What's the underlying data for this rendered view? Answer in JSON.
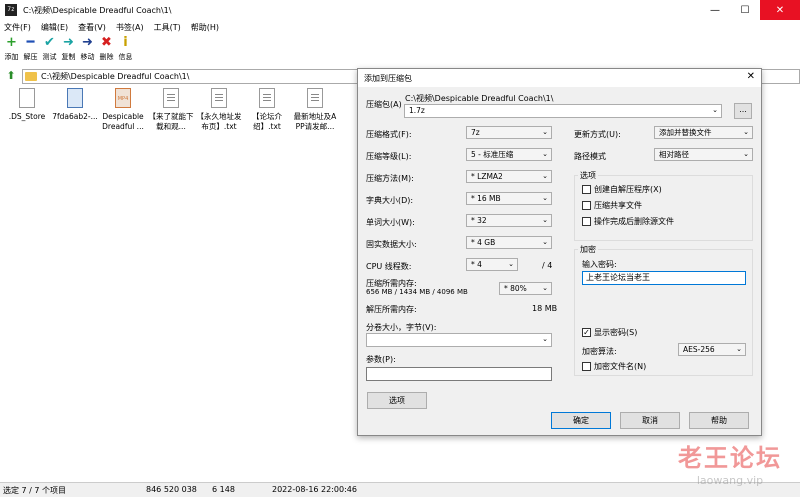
{
  "window": {
    "app_icon": "7z",
    "title": "C:\\视频\\Despicable Dreadful Coach\\1\\",
    "controls": {
      "minimize": "—",
      "maximize": "☐",
      "close": "✕"
    }
  },
  "menu": [
    "文件(F)",
    "编辑(E)",
    "查看(V)",
    "书签(A)",
    "工具(T)",
    "帮助(H)"
  ],
  "toolbar": [
    {
      "label": "添加",
      "icon": "plus-icon",
      "glyph": "+",
      "color": "#2ca02c"
    },
    {
      "label": "解压",
      "icon": "minus-icon",
      "glyph": "━",
      "color": "#1f4fb5"
    },
    {
      "label": "测试",
      "icon": "test-check-icon",
      "glyph": "✔",
      "color": "#1aa3a3"
    },
    {
      "label": "复制",
      "icon": "copy-arrow-icon",
      "glyph": "➜",
      "color": "#1aa3a3"
    },
    {
      "label": "移动",
      "icon": "move-arrow-icon",
      "glyph": "➜",
      "color": "#1f3f8f"
    },
    {
      "label": "删除",
      "icon": "delete-x-icon",
      "glyph": "✖",
      "color": "#d62020"
    },
    {
      "label": "信息",
      "icon": "info-icon",
      "glyph": "i",
      "color": "#c8a000"
    }
  ],
  "address": {
    "path": "C:\\视频\\Despicable Dreadful Coach\\1\\"
  },
  "files": [
    {
      "name": ".DS_Store",
      "type": "blank"
    },
    {
      "name": "7fda6ab2-...",
      "type": "img"
    },
    {
      "name": "Despicable Dreadful ...",
      "type": "mp4",
      "badge": "MP4"
    },
    {
      "name": "【来了就能下载和观...",
      "type": "txt"
    },
    {
      "name": "【永久地址发布页】.txt",
      "type": "txt"
    },
    {
      "name": "【论坛介绍】.txt",
      "type": "txt"
    },
    {
      "name": "最新地址及APP请发邮...",
      "type": "txt"
    }
  ],
  "status": {
    "selection": "选定 7 / 7 个项目",
    "size": "846 520 038",
    "packed": "6 148",
    "modified": "2022-08-16 22:00:46"
  },
  "watermark": {
    "text": "老王论坛",
    "url": "laowang.vip"
  },
  "dialog": {
    "title": "添加到压缩包",
    "close": "✕",
    "archive_label": "压缩包(A)",
    "archive_dir": "C:\\视频\\Despicable Dreadful Coach\\1\\",
    "archive_name": "1.7z",
    "browse": "...",
    "format_label": "压缩格式(F):",
    "format": "7z",
    "level_label": "压缩等级(L):",
    "level": "5 - 标准压缩",
    "method_label": "压缩方法(M):",
    "method": "* LZMA2",
    "dict_label": "字典大小(D):",
    "dict": "* 16 MB",
    "word_label": "单词大小(W):",
    "word": "* 32",
    "solid_label": "固实数据大小:",
    "solid": "* 4 GB",
    "cpu_label": "CPU 线程数:",
    "cpu": "* 4",
    "cpu_total": "/ 4",
    "mem_label": "压缩所需内存:",
    "mem_value": "656 MB / 1434 MB / 4096 MB",
    "mem_percent": "* 80%",
    "decomp_label": "解压所需内存:",
    "decomp_value": "18 MB",
    "split_label": "分卷大小，字节(V):",
    "split_value": "",
    "params_label": "参数(P):",
    "params_value": "",
    "options_btn": "选项",
    "update_label": "更新方式(U):",
    "update": "添加并替换文件",
    "path_label": "路径模式",
    "path_mode": "相对路径",
    "opts_group": "选项",
    "opt_sfx": "创建自解压程序(X)",
    "opt_shared": "压缩共享文件",
    "opt_delete": "操作完成后删除源文件",
    "enc_group": "加密",
    "pwd_label": "输入密码:",
    "pwd_value": "上老王论坛当老王",
    "show_pwd": "显示密码(S)",
    "enc_method_label": "加密算法:",
    "enc_method": "AES-256",
    "enc_names": "加密文件名(N)",
    "ok": "确定",
    "cancel": "取消",
    "help": "帮助"
  }
}
